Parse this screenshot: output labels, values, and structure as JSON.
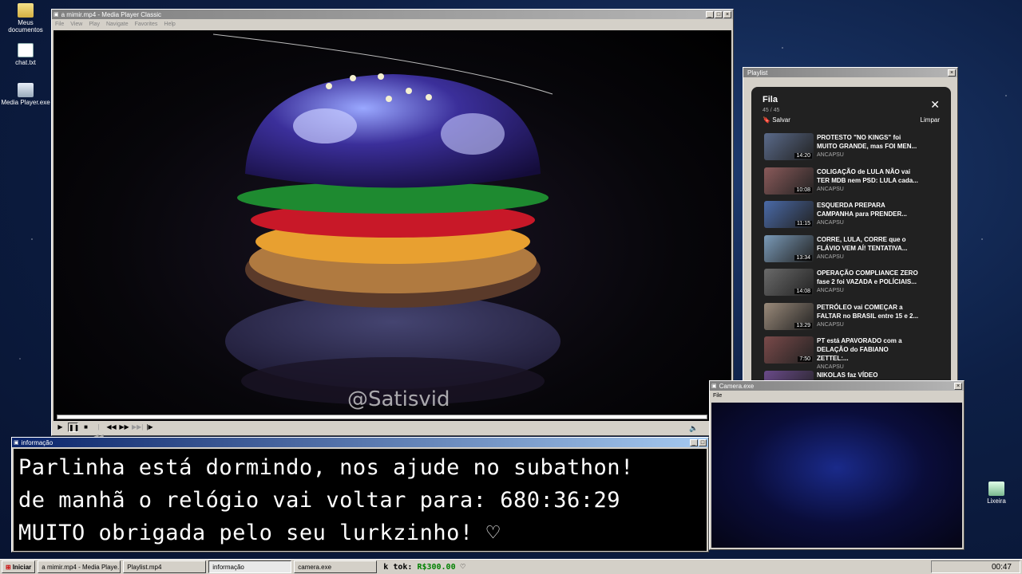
{
  "desktop": {
    "icons": [
      {
        "label": "Meus documentos",
        "icon": "folder-icon"
      },
      {
        "label": "chat.txt",
        "icon": "text-file-icon"
      },
      {
        "label": "Media Player.exe",
        "icon": "exe-icon"
      },
      {
        "label": "Lixeira",
        "icon": "recycle-bin-icon"
      }
    ]
  },
  "player": {
    "title": "a mimir.mp4 - Media Player Classic",
    "menu": [
      "File",
      "View",
      "Play",
      "Navigate",
      "Favorites",
      "Help"
    ],
    "watermark": "@Satisvid"
  },
  "playlist": {
    "window_title": "Playlist",
    "title": "Fila",
    "count": "45 / 45",
    "save_label": "Salvar",
    "clear_label": "Limpar",
    "items": [
      {
        "title": "PROTESTO \"NO KINGS\" foi MUITO GRANDE, mas FOI MEN...",
        "channel": "ANCAPSU",
        "duration": "14:20"
      },
      {
        "title": "COLIGAÇÃO de LULA NÃO vai TER MDB nem PSD: LULA cada...",
        "channel": "ANCAPSU",
        "duration": "10:08"
      },
      {
        "title": "ESQUERDA PREPARA CAMPANHA para PRENDER...",
        "channel": "ANCAPSU",
        "duration": "11:15"
      },
      {
        "title": "CORRE, LULA, CORRE que o FLÁVIO VEM AÍ! TENTATIVA...",
        "channel": "ANCAPSU",
        "duration": "13:34"
      },
      {
        "title": "OPERAÇÃO COMPLIANCE ZERO fase 2 foi VAZADA e POLÍCIAIS...",
        "channel": "ANCAPSU",
        "duration": "14:08"
      },
      {
        "title": "PETRÓLEO vai COMEÇAR a FALTAR no BRASIL entre 15 e 2...",
        "channel": "ANCAPSU",
        "duration": "13:29"
      },
      {
        "title": "PT está APAVORADO com a DELAÇÃO do FABIANO ZETTEL:...",
        "channel": "ANCAPSU",
        "duration": "7:50"
      },
      {
        "title": "NIKOLAS faz VÍDEO",
        "channel": "",
        "duration": ""
      }
    ]
  },
  "info": {
    "title": "informação",
    "line1": "Parlinha está dormindo, nos ajude no subathon!",
    "line2": "de manhã o relógio vai voltar para:  680:36:29",
    "line3": "MUITO obrigada pelo seu lurkzinho! ♡"
  },
  "camera": {
    "title": "Camera.exe",
    "menu": "File"
  },
  "taskbar": {
    "start": "Iniciar",
    "tasks": [
      "a mimir.mp4 - Media Playe...",
      "Playlist.mp4",
      "informação",
      "camera.exe"
    ],
    "tok_label": "k tok:",
    "tok_value": "R$300.00",
    "tok_heart": "♡",
    "clock": "00:47"
  },
  "colors": {
    "title_active": "#0a246a",
    "money": "#008000",
    "desktop": "#0d1f45"
  }
}
